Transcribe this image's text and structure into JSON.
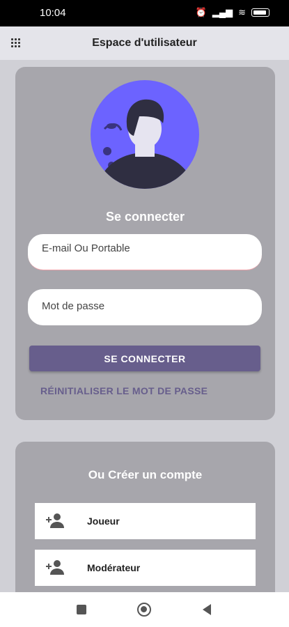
{
  "status_bar": {
    "time": "10:04",
    "icons": [
      "alarm-off-icon",
      "alarm-icon",
      "signal-icon",
      "signal-icon",
      "wifi-icon",
      "battery-icon"
    ]
  },
  "app_bar": {
    "title": "Espace d'utilisateur",
    "menu_icon": "grid-icon"
  },
  "login": {
    "title": "Se connecter",
    "email_placeholder": "E-mail Ou Portable",
    "password_placeholder": "Mot de passe",
    "login_button": "SE CONNECTER",
    "reset_link": "RÉINITIALISER LE MOT DE PASSE"
  },
  "create": {
    "title": "Ou Créer un compte",
    "options": [
      {
        "label": "Joueur",
        "icon": "add-user-icon"
      },
      {
        "label": "Modérateur",
        "icon": "add-user-icon"
      }
    ]
  },
  "colors": {
    "accent": "#675e8c",
    "card": "#a7a6ac",
    "avatar_bg": "#6c63ff"
  }
}
